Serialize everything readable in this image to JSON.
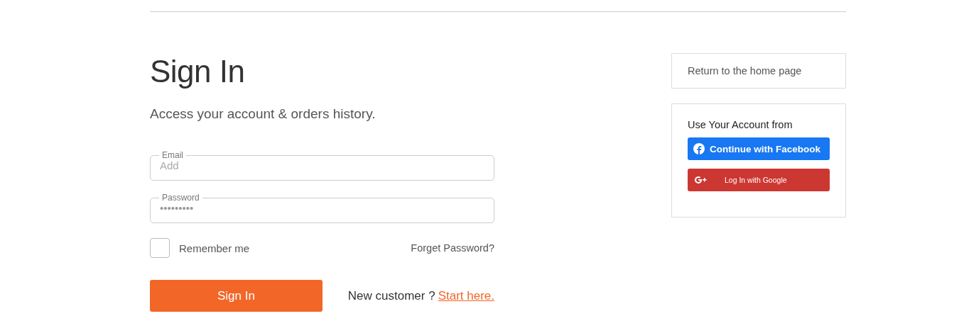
{
  "heading": "Sign In",
  "subtitle": "Access your account & orders history.",
  "fields": [
    {
      "label": "Email",
      "placeholder": "Add"
    },
    {
      "label": "Password",
      "value": "•••••••••"
    }
  ],
  "remember": {
    "label": "Remember me",
    "checked": false
  },
  "forgot_link": "Forget Password?",
  "submit_button": "Sign In",
  "signup": {
    "text": "New customer ?",
    "link": "Start here."
  },
  "side": {
    "home_link": "Return to the home page",
    "social_title": "Use Your Account from",
    "social_buttons": [
      {
        "kind": "facebook",
        "label": "Continue with Facebook"
      },
      {
        "kind": "google",
        "label": "Log In with Google"
      }
    ]
  }
}
